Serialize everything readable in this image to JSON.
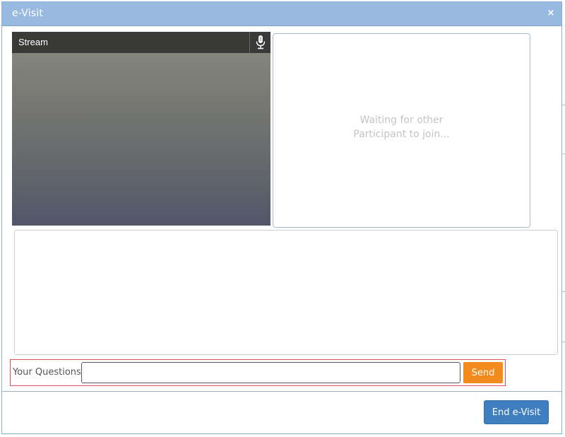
{
  "window": {
    "title": "e-Visit",
    "close_glyph": "×"
  },
  "stream": {
    "label": "Stream",
    "mic_icon": "microphone-icon"
  },
  "remote": {
    "waiting_line1": "Waiting for other",
    "waiting_line2": "Participant to join..."
  },
  "question": {
    "label": "Your Questions",
    "input_value": "",
    "send_label": "Send"
  },
  "footer": {
    "end_label": "End e-Visit"
  },
  "colors": {
    "titlebar": "#98b9e0",
    "send_button": "#f28a1e",
    "end_button": "#3f7fc0",
    "highlight_border": "#e0534e"
  }
}
